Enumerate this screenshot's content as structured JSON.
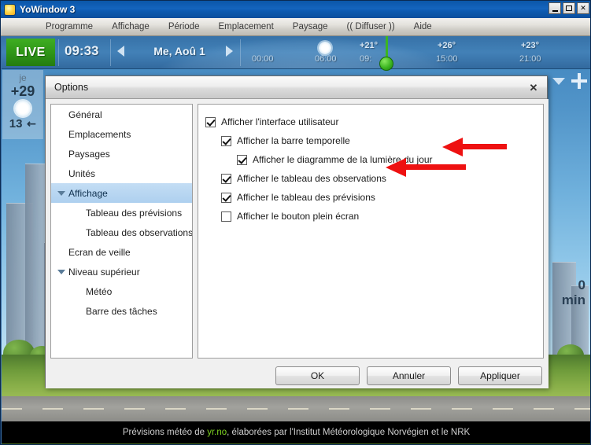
{
  "window": {
    "title": "YoWindow 3",
    "icon": "sun-icon",
    "controls": {
      "minimize": "minimize-icon",
      "maximize": "maximize-icon",
      "close": "close-icon"
    }
  },
  "menubar": {
    "items": [
      {
        "label": "Programme"
      },
      {
        "label": "Affichage"
      },
      {
        "label": "Période"
      },
      {
        "label": "Emplacement"
      },
      {
        "label": "Paysage"
      },
      {
        "label": "(( Diffuser ))"
      },
      {
        "label": "Aide"
      }
    ]
  },
  "timeline": {
    "live_label": "LIVE",
    "clock": "09:33",
    "date": "Me, Aoû 1",
    "prev_icon": "chevron-left-icon",
    "next_icon": "chevron-right-icon",
    "now_time": "09:",
    "ticks": [
      {
        "time": "00:00",
        "temp": ""
      },
      {
        "time": "06:00",
        "temp": ""
      },
      {
        "time": "15:00",
        "temp": "+26°"
      },
      {
        "time": "21:00",
        "temp": "+23°"
      }
    ],
    "now_temp": "+21°",
    "sun_icon": "sun-icon"
  },
  "left_widget": {
    "day": "je",
    "temp": "+29",
    "icon": "sun-icon",
    "value": "13",
    "wind_arrow": "↖"
  },
  "right_controls": {
    "dropdown_icon": "chevron-down-icon",
    "add_icon": "plus-icon",
    "minutes_value": "0",
    "minutes_unit": "min"
  },
  "credit": {
    "prefix": "Prévisions météo de ",
    "link": "yr.no",
    "suffix": ", élaborées par l'Institut Météorologique Norvégien et le NRK"
  },
  "dialog": {
    "title": "Options",
    "close_icon": "close-icon",
    "sidebar": [
      {
        "label": "Général",
        "level": 1,
        "selected": false,
        "caret": false
      },
      {
        "label": "Emplacements",
        "level": 1,
        "selected": false,
        "caret": false
      },
      {
        "label": "Paysages",
        "level": 1,
        "selected": false,
        "caret": false
      },
      {
        "label": "Unités",
        "level": 1,
        "selected": false,
        "caret": false
      },
      {
        "label": "Affichage",
        "level": 1,
        "selected": true,
        "caret": true
      },
      {
        "label": "Tableau des prévisions",
        "level": 2,
        "selected": false,
        "caret": false
      },
      {
        "label": "Tableau des observations",
        "level": 2,
        "selected": false,
        "caret": false
      },
      {
        "label": "Ecran de veille",
        "level": 1,
        "selected": false,
        "caret": false
      },
      {
        "label": "Niveau supérieur",
        "level": 1,
        "selected": false,
        "caret": true
      },
      {
        "label": "Météo",
        "level": 2,
        "selected": false,
        "caret": false
      },
      {
        "label": "Barre des tâches",
        "level": 2,
        "selected": false,
        "caret": false
      }
    ],
    "options": [
      {
        "label": "Afficher l'interface utilisateur",
        "checked": true,
        "indent": 0
      },
      {
        "label": "Afficher la barre temporelle",
        "checked": true,
        "indent": 1
      },
      {
        "label": "Afficher le diagramme de la lumière du jour",
        "checked": true,
        "indent": 2
      },
      {
        "label": "Afficher le tableau des observations",
        "checked": true,
        "indent": 1
      },
      {
        "label": "Afficher le tableau des prévisions",
        "checked": true,
        "indent": 1
      },
      {
        "label": "Afficher le bouton plein écran",
        "checked": false,
        "indent": 1
      }
    ],
    "buttons": {
      "ok": "OK",
      "cancel": "Annuler",
      "apply": "Appliquer"
    }
  },
  "annotations": {
    "arrow_color": "#ee1111",
    "arrows": [
      {
        "points_to": "Afficher le diagramme de la lumière du jour"
      },
      {
        "points_to": "Afficher le tableau des observations"
      }
    ]
  }
}
